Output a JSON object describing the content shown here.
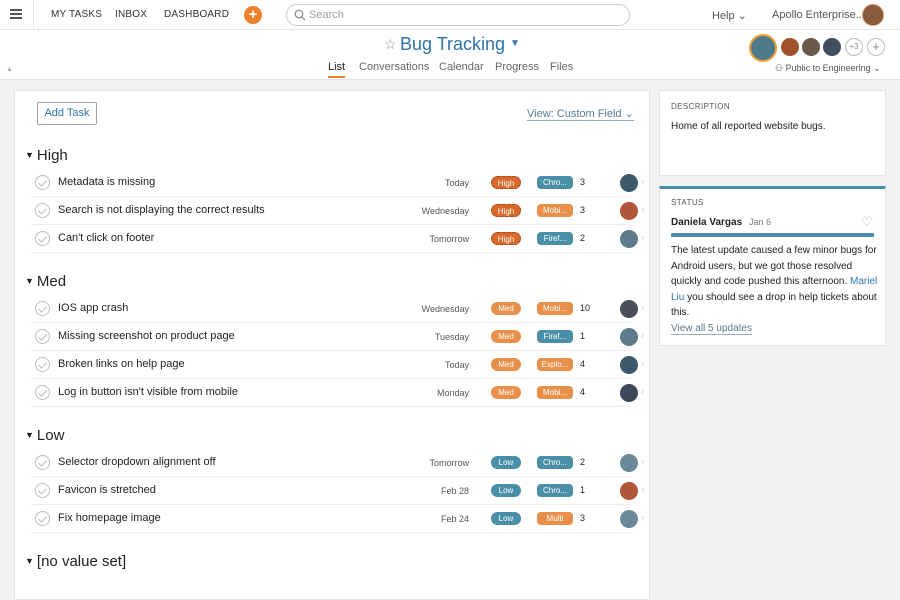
{
  "topnav": {
    "links": [
      "MY TASKS",
      "INBOX",
      "DASHBOARD"
    ],
    "add_label": "+",
    "search_placeholder": "Search",
    "help": "Help ⌄",
    "org": "Apollo Enterprise..."
  },
  "project": {
    "title": "Bug Tracking",
    "tabs": [
      "List",
      "Conversations",
      "Calendar",
      "Progress",
      "Files"
    ],
    "active_tab": "List",
    "more_members": "+3",
    "privacy": "Public to Engineering ⌄"
  },
  "list": {
    "add_task": "Add Task",
    "view_select": "View: Custom Field ⌄",
    "sections": [
      {
        "name": "High",
        "tasks": [
          {
            "name": "Metadata is missing",
            "due": "Today",
            "priority": "High",
            "tag": "Chro...",
            "tag_color": "#4a8fa8",
            "count": "3",
            "avatar_color": "#3e5a6a"
          },
          {
            "name": "Search is not displaying the correct results",
            "due": "Wednesday",
            "priority": "High",
            "tag": "Mobi...",
            "tag_color": "#e8904a",
            "count": "3",
            "avatar_color": "#b0563a"
          },
          {
            "name": "Can't click on footer",
            "due": "Tomorrow",
            "priority": "High",
            "tag": "Firef...",
            "tag_color": "#4a8fa8",
            "count": "2",
            "avatar_color": "#5f7a8a"
          }
        ]
      },
      {
        "name": "Med",
        "tasks": [
          {
            "name": "IOS app crash",
            "due": "Wednesday",
            "priority": "Med",
            "tag": "Mobi...",
            "tag_color": "#e8904a",
            "count": "10",
            "avatar_color": "#4a4f5a"
          },
          {
            "name": "Missing screenshot on product page",
            "due": "Tuesday",
            "priority": "Med",
            "tag": "Firef...",
            "tag_color": "#4a8fa8",
            "count": "1",
            "avatar_color": "#5f7a8a"
          },
          {
            "name": "Broken links on help page",
            "due": "Today",
            "priority": "Med",
            "tag": "Explo...",
            "tag_color": "#e8904a",
            "count": "4",
            "avatar_color": "#3e5a6a"
          },
          {
            "name": "Log in button isn't visible from mobile",
            "due": "Monday",
            "priority": "Med",
            "tag": "Mobi...",
            "tag_color": "#e8904a",
            "count": "4",
            "avatar_color": "#3e4a5a"
          }
        ]
      },
      {
        "name": "Low",
        "tasks": [
          {
            "name": "Selector dropdown alignment off",
            "due": "Tomorrow",
            "priority": "Low",
            "tag": "Chro...",
            "tag_color": "#4a8fa8",
            "count": "2",
            "avatar_color": "#6a8a9a"
          },
          {
            "name": "Favicon is stretched",
            "due": "Feb 28",
            "priority": "Low",
            "tag": "Chro...",
            "tag_color": "#4a8fa8",
            "count": "1",
            "avatar_color": "#b0563a"
          },
          {
            "name": "Fix homepage image",
            "due": "Feb 24",
            "priority": "Low",
            "tag": "Multi",
            "tag_color": "#e8904a",
            "count": "3",
            "avatar_color": "#6a8a9a"
          }
        ]
      },
      {
        "name": "[no value set]",
        "tasks": []
      }
    ]
  },
  "colors": {
    "high": "#d9692a",
    "med": "#e8904a",
    "low": "#4a8fa8"
  },
  "description": {
    "label": "DESCRIPTION",
    "text": "Home of all reported website bugs."
  },
  "status": {
    "label": "STATUS",
    "author": "Daniela Vargas",
    "date": "Jan 6",
    "body_before": "The latest update caused a few minor bugs for Android users, but we got those resolved quickly and code pushed this afternoon. ",
    "mention": "Mariel Liu",
    "body_after": " you should see a drop in help tickets about this.",
    "view_all": "View all 5 updates"
  }
}
